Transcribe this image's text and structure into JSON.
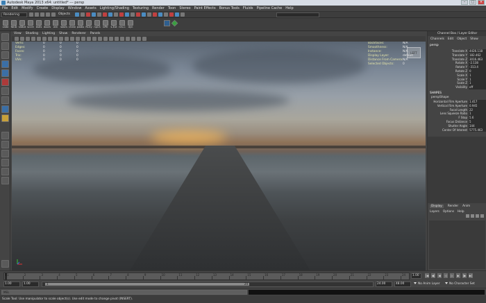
{
  "window": {
    "title": "Autodesk Maya 2013 x64: untitled*   ---   persp"
  },
  "menubar": [
    "File",
    "Edit",
    "Modify",
    "Create",
    "Display",
    "Window",
    "Assets",
    "Lighting/Shading",
    "Texturing",
    "Render",
    "Toon",
    "Stereo",
    "Paint Effects",
    "Bonus Tools",
    "Fluids",
    "Pipeline Cache",
    "Help"
  ],
  "statusline": {
    "mode": "Rendering",
    "objects_label": "Objects"
  },
  "shelf": {
    "tools": [
      "catbl",
      "fbtlD",
      "sSBat",
      "sccre",
      "bstls",
      "doors",
      "win",
      "stairs",
      "chest",
      "pwlbs",
      "RCity",
      "npCS",
      "bPtr",
      "s-Ext",
      "nm-C",
      "dyn"
    ]
  },
  "viewport_panel": {
    "menus": [
      "View",
      "Shading",
      "Lighting",
      "Show",
      "Renderer",
      "Panels"
    ],
    "hud_left": [
      {
        "label": "Verts:",
        "values": [
          "0",
          "0",
          "0"
        ]
      },
      {
        "label": "Edges:",
        "values": [
          "0",
          "0",
          "0"
        ]
      },
      {
        "label": "Faces:",
        "values": [
          "0",
          "0",
          "0"
        ]
      },
      {
        "label": "Tris:",
        "values": [
          "0",
          "0",
          "0"
        ]
      },
      {
        "label": "UVs:",
        "values": [
          "0",
          "0",
          "0"
        ]
      }
    ],
    "hud_right": [
      {
        "label": "Backfaces:",
        "value": "N/A"
      },
      {
        "label": "Smoothness:",
        "value": "N/A"
      },
      {
        "label": "Instance:",
        "value": "N/A"
      },
      {
        "label": "Display Layer:",
        "value": "default"
      },
      {
        "label": "Distance From Camera:",
        "value": "N/A"
      },
      {
        "label": "Selected Objects:",
        "value": "0"
      }
    ],
    "viewcube_label": "LEFT"
  },
  "channel_box": {
    "title": "Channel Box / Layer Editor",
    "tabs": [
      "Channels",
      "Edit",
      "Object",
      "Show"
    ],
    "object": "persp",
    "attrs": [
      {
        "name": "Translate X",
        "value": "4426.118"
      },
      {
        "name": "Translate Y",
        "value": "182.462"
      },
      {
        "name": "Translate Z",
        "value": "3016.463"
      },
      {
        "name": "Rotate X",
        "value": "-2.138"
      },
      {
        "name": "Rotate Y",
        "value": "-313.4"
      },
      {
        "name": "Rotate Z",
        "value": "0"
      },
      {
        "name": "Scale X",
        "value": "1"
      },
      {
        "name": "Scale Y",
        "value": "1"
      },
      {
        "name": "Scale Z",
        "value": "1"
      },
      {
        "name": "Visibility",
        "value": "off"
      }
    ],
    "shapes_label": "SHAPES",
    "shape_name": "perspShape",
    "shape_attrs": [
      {
        "name": "Horizontal Film Aperture",
        "value": "1.417"
      },
      {
        "name": "Vertical Film Aperture",
        "value": "0.945"
      },
      {
        "name": "Focal Length",
        "value": "22"
      },
      {
        "name": "Lens Squeeze Ratio",
        "value": "1"
      },
      {
        "name": "F Stop",
        "value": "5.6"
      },
      {
        "name": "Focus Distance",
        "value": "5"
      },
      {
        "name": "Shutter Angle",
        "value": "144"
      },
      {
        "name": "Center Of Interest",
        "value": "5775.463"
      }
    ]
  },
  "layer_editor": {
    "tabs": [
      "Display",
      "Render",
      "Anim"
    ],
    "menus": [
      "Layers",
      "Options",
      "Help"
    ]
  },
  "time_slider": {
    "ticks": [
      "1",
      "2",
      "3",
      "4",
      "5",
      "6",
      "7",
      "8",
      "9",
      "10",
      "11",
      "12",
      "13",
      "14",
      "15",
      "16",
      "17",
      "18",
      "19",
      "20",
      "21",
      "22",
      "23",
      "24"
    ],
    "current": "1.00"
  },
  "range_slider": {
    "start": "1.00",
    "playback_start": "1.00",
    "bar_start_label": "1",
    "bar_end_label": "24",
    "playback_end": "24.00",
    "end": "48.00",
    "anim_layer": "No Anim Layer",
    "character_set": "No Character Set"
  },
  "command_line": {
    "lang": "MEL"
  },
  "help_line": {
    "text": "Scale Tool: Use manipulator to scale object(s). Use edit mode to change pivot (INSERT)."
  }
}
